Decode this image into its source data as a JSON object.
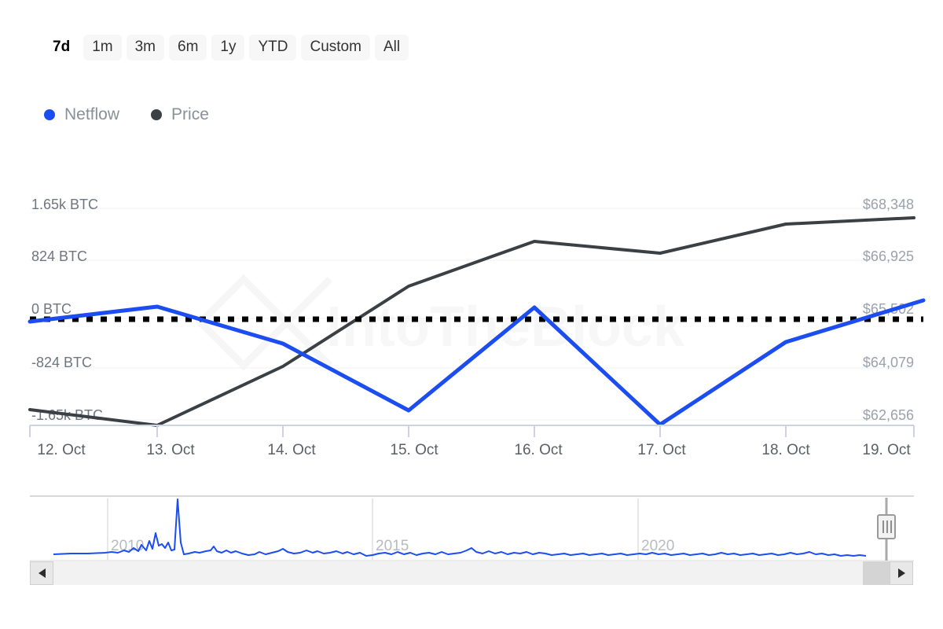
{
  "range_selector": {
    "name": "time-range-selector",
    "options": [
      {
        "label": "7d",
        "active": true
      },
      {
        "label": "1m",
        "active": false
      },
      {
        "label": "3m",
        "active": false
      },
      {
        "label": "6m",
        "active": false
      },
      {
        "label": "1y",
        "active": false
      },
      {
        "label": "YTD",
        "active": false
      },
      {
        "label": "Custom",
        "active": false
      },
      {
        "label": "All",
        "active": false
      }
    ]
  },
  "legend": {
    "items": [
      {
        "label": "Netflow",
        "color": "#1b4df0",
        "icon": "circle-icon"
      },
      {
        "label": "Price",
        "color": "#3b4045",
        "icon": "circle-icon"
      }
    ]
  },
  "watermark": {
    "text": "IntoTheBlock",
    "color": "#f2f2f2"
  },
  "navigator": {
    "year_labels": [
      "2010",
      "2015",
      "2020"
    ],
    "series_color": "#1b4df0",
    "handle_icon": "drag-handle-icon"
  },
  "scrollbar": {
    "left_arrow_icon": "arrow-left-icon",
    "right_arrow_icon": "arrow-right-icon"
  },
  "chart_data": {
    "type": "line",
    "title": "",
    "xlabel": "",
    "grid": true,
    "legend_position": "top-left",
    "x": [
      "12. Oct",
      "13. Oct",
      "14. Oct",
      "15. Oct",
      "16. Oct",
      "17. Oct",
      "18. Oct",
      "19. Oct"
    ],
    "axes": {
      "left": {
        "label": "Netflow",
        "ticks": [
          "1.65k BTC",
          "824 BTC",
          "0 BTC",
          "-824 BTC",
          "-1.65k BTC"
        ],
        "tick_values": [
          1650,
          824,
          0,
          -824,
          -1650
        ],
        "ylim": [
          -1650,
          1650
        ]
      },
      "right": {
        "label": "Price",
        "ticks": [
          "$68,348",
          "$66,925",
          "$65,502",
          "$64,079",
          "$62,656"
        ],
        "tick_values": [
          68348,
          66925,
          65502,
          64079,
          62656
        ],
        "ylim": [
          62656,
          68348
        ]
      }
    },
    "zero_line": {
      "value": 0,
      "style": "dotted",
      "color": "#000000"
    },
    "series": [
      {
        "name": "Netflow",
        "color": "#1b4df0",
        "axis": "left",
        "unit": "BTC",
        "values": [
          -80,
          190,
          -420,
          -1530,
          160,
          -1760,
          -580,
          250
        ]
      },
      {
        "name": "Price",
        "color": "#3b4045",
        "axis": "right",
        "unit": "USD",
        "values": [
          62960,
          62660,
          64200,
          66000,
          67160,
          66860,
          67880,
          68230
        ]
      }
    ]
  }
}
